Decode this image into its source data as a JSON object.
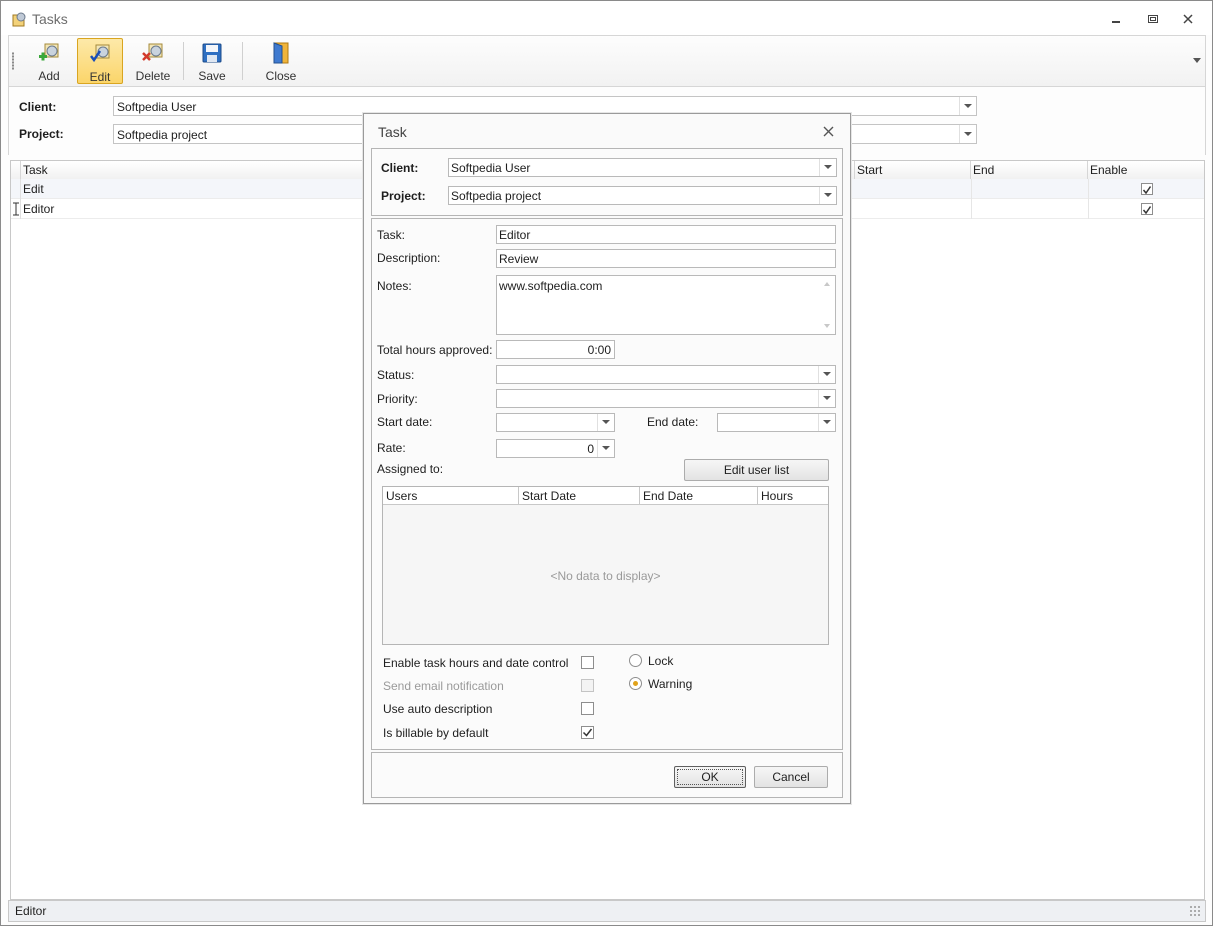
{
  "window": {
    "title": "Tasks"
  },
  "toolbar": {
    "add": "Add",
    "edit": "Edit",
    "delete": "Delete",
    "save": "Save",
    "close": "Close"
  },
  "filter": {
    "client_label": "Client:",
    "client_value": "Softpedia User",
    "project_label": "Project:",
    "project_value": "Softpedia project"
  },
  "grid": {
    "columns": {
      "task": "Task",
      "start": "Start",
      "end": "End",
      "enable": "Enable"
    },
    "rows": [
      {
        "task": "Edit",
        "enabled": true
      },
      {
        "task": "Editor",
        "enabled": true
      }
    ]
  },
  "status_bar": {
    "text": "Editor"
  },
  "dialog": {
    "title": "Task",
    "client_label": "Client:",
    "client_value": "Softpedia User",
    "project_label": "Project:",
    "project_value": "Softpedia project",
    "task_label": "Task:",
    "task_value": "Editor",
    "description_label": "Description:",
    "description_value": "Review",
    "notes_label": "Notes:",
    "notes_value": "www.softpedia.com",
    "hours_label": "Total hours approved:",
    "hours_value": "0:00",
    "status_label": "Status:",
    "status_value": "",
    "priority_label": "Priority:",
    "priority_value": "",
    "start_date_label": "Start date:",
    "start_date_value": "",
    "end_date_label": "End date:",
    "end_date_value": "",
    "rate_label": "Rate:",
    "rate_value": "0",
    "assigned_label": "Assigned to:",
    "edit_user_list": "Edit user list",
    "users_columns": {
      "users": "Users",
      "start_date": "Start Date",
      "end_date": "End Date",
      "hours": "Hours"
    },
    "no_data": "<No data to display>",
    "options": {
      "enable_control": "Enable task hours and date control",
      "send_email": "Send email notification",
      "auto_description": "Use auto description",
      "billable": "Is billable by default"
    },
    "radios": {
      "lock": "Lock",
      "warning": "Warning"
    },
    "ok": "OK",
    "cancel": "Cancel"
  }
}
